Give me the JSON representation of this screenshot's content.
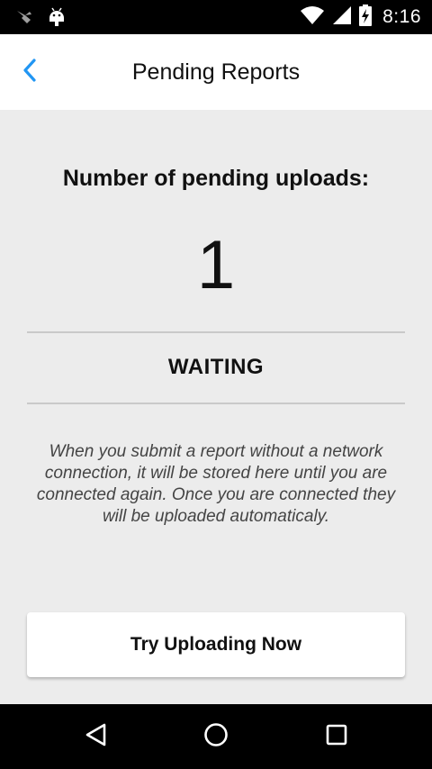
{
  "status_bar": {
    "time": "8:16",
    "icons": [
      "notification-bird-icon",
      "android-icon",
      "wifi-icon",
      "signal-icon",
      "battery-charging-icon"
    ]
  },
  "app_bar": {
    "title": "Pending Reports",
    "back_icon": "chevron-left-icon",
    "accent_color": "#2196f3"
  },
  "main": {
    "count_heading": "Number of pending uploads:",
    "count_value": "1",
    "status": "WAITING",
    "info": "When you submit a report without a network connection, it will be stored here until you are connected again. Once you are connected they will be uploaded automaticaly.",
    "upload_button_label": "Try Uploading Now"
  },
  "nav_bar": {
    "buttons": [
      "back-triangle-icon",
      "home-circle-icon",
      "recents-square-icon"
    ]
  }
}
